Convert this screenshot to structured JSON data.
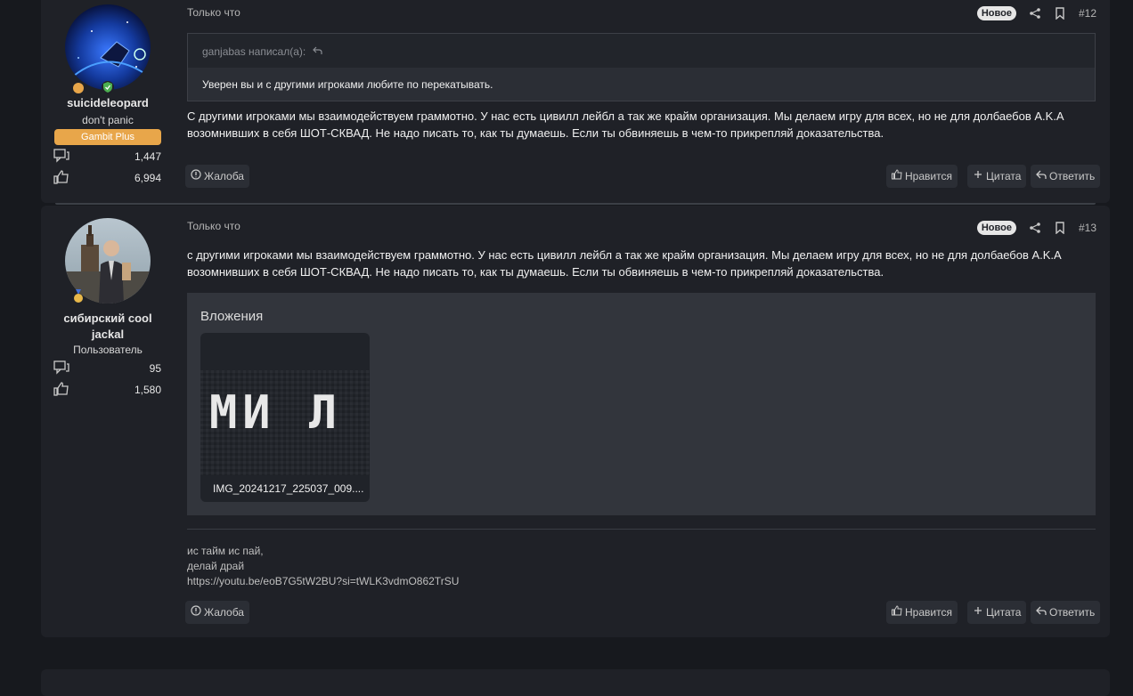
{
  "posts": [
    {
      "username": "suicideleopard",
      "user_title": "don't panic",
      "user_banner": "Gambit Plus",
      "messages_count": "1,447",
      "reactions_count": "6,994",
      "time": "Только что",
      "new_label": "Новое",
      "post_number": "#12",
      "quote_author": "ganjabas написал(а):",
      "quote_text": "Уверен вы и с другими игроками любите по перекатывать.",
      "message_line1": "С другими игроками мы взаимодействуем граммотно. У нас есть цивилл лейбл а так же крайм организация. Мы делаем игру для всех, но не для долбаебов A.K.A",
      "message_line2": "возомнивших в себя ШОТ-СКВАД. Не надо писать то, как ты думаешь. Если ты обвиняешь в чем-то прикрепляй доказательства.",
      "report_label": "Жалоба",
      "like_label": "Нравится",
      "quote_label": "Цитата",
      "reply_label": "Ответить"
    },
    {
      "username_line1": "сибирский cool",
      "username_line2": "jackal",
      "user_title": "Пользователь",
      "messages_count": "95",
      "reactions_count": "1,580",
      "time": "Только что",
      "new_label": "Новое",
      "post_number": "#13",
      "message_line1": "с другими игроками мы взаимодействуем граммотно. У нас есть цивилл лейбл а так же крайм организация. Мы делаем игру для всех, но не для долбаебов A.K.A",
      "message_line2": "возомнивших в себя ШОТ-СКВАД. Не надо писать то, как ты думаешь. Если ты обвиняешь в чем-то прикрепляй доказательства.",
      "attachments_title": "Вложения",
      "attachment_name": "IMG_20241217_225037_009....",
      "attachment_preview_text": "МИ Л",
      "signature_line1": "ис тайм ис пай,",
      "signature_line2": "делай драй",
      "signature_link": "https://youtu.be/eoB7G5tW2BU?si=tWLK3vdmO862TrSU",
      "report_label": "Жалоба",
      "like_label": "Нравится",
      "quote_label": "Цитата",
      "reply_label": "Ответить"
    }
  ],
  "icons": {
    "messages": "messages-icon",
    "reactions": "thumbs-up-icon",
    "share": "share-icon",
    "bookmark": "bookmark-icon",
    "report": "report-icon",
    "like": "like-icon",
    "quote": "plus-icon",
    "reply": "reply-icon",
    "quote_jump": "quote-jump-icon"
  },
  "colors": {
    "background": "#17191e",
    "post_background": "#1f2127",
    "banner": "#e8a64a",
    "new_badge": "#e6e6e6"
  }
}
